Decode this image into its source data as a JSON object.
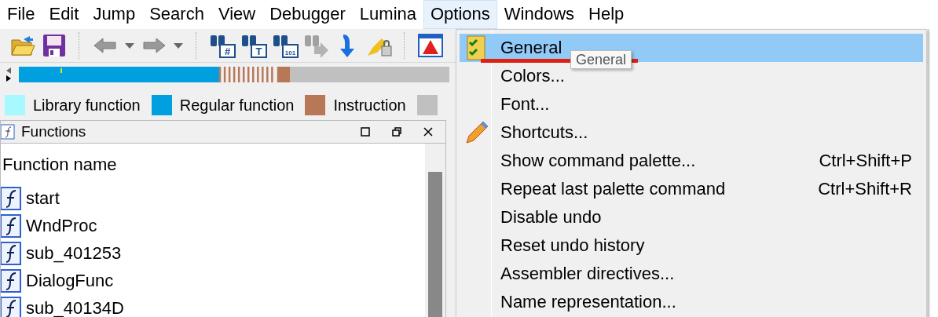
{
  "menu_bar": [
    {
      "label": "File",
      "selected": false
    },
    {
      "label": "Edit",
      "selected": false
    },
    {
      "label": "Jump",
      "selected": false
    },
    {
      "label": "Search",
      "selected": false
    },
    {
      "label": "View",
      "selected": false
    },
    {
      "label": "Debugger",
      "selected": false
    },
    {
      "label": "Lumina",
      "selected": false
    },
    {
      "label": "Options",
      "selected": true
    },
    {
      "label": "Windows",
      "selected": false
    },
    {
      "label": "Help",
      "selected": false
    }
  ],
  "toolbar": [
    {
      "kind": "open"
    },
    {
      "kind": "save"
    },
    {
      "kind": "sep"
    },
    {
      "kind": "back"
    },
    {
      "kind": "caret"
    },
    {
      "kind": "forward"
    },
    {
      "kind": "caret"
    },
    {
      "kind": "sep"
    },
    {
      "kind": "find",
      "glyph": "#"
    },
    {
      "kind": "find",
      "glyph": "T"
    },
    {
      "kind": "find",
      "glyph": "101"
    },
    {
      "kind": "find-next",
      "disabled": true
    },
    {
      "kind": "jump"
    },
    {
      "kind": "highlight"
    },
    {
      "kind": "sep"
    },
    {
      "kind": "warning"
    }
  ],
  "legend": [
    {
      "label": "Library function",
      "color": "#a8f8ff"
    },
    {
      "label": "Regular function",
      "color": "#00a0e0"
    },
    {
      "label": "Instruction",
      "color": "#b87858"
    },
    {
      "color": "#c0c0c0"
    }
  ],
  "functions_panel": {
    "title": "Functions",
    "column": "Function name",
    "rows": [
      "start",
      "WndProc",
      "sub_401253",
      "DialogFunc",
      "sub_40134D"
    ]
  },
  "options_menu": [
    {
      "label": "General",
      "kind": "checklist",
      "selected": true
    },
    {
      "label": "Colors...",
      "selected": false
    },
    {
      "label": "Font...",
      "selected": false
    },
    {
      "label": "Shortcuts...",
      "kind": "pencil",
      "selected": false
    },
    {
      "label": "Show command palette...",
      "shortcut": "Ctrl+Shift+P",
      "selected": false
    },
    {
      "label": "Repeat last palette command",
      "shortcut": "Ctrl+Shift+R",
      "selected": false
    },
    {
      "label": "Disable undo",
      "selected": false
    },
    {
      "label": "Reset undo history",
      "selected": false
    },
    {
      "label": "Assembler directives...",
      "selected": false
    },
    {
      "label": "Name representation...",
      "selected": false
    }
  ],
  "tooltip": "General"
}
